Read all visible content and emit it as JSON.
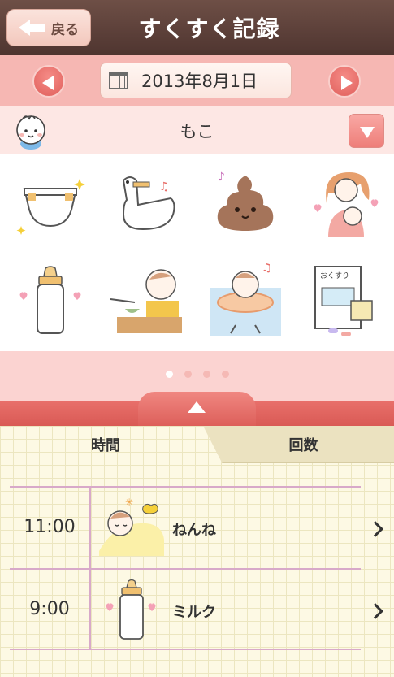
{
  "header": {
    "back_label": "戻る",
    "title": "すくすく記録"
  },
  "datebar": {
    "date": "2013年8月1日"
  },
  "baby": {
    "name": "もこ"
  },
  "grid": {
    "items": [
      {
        "icon": "diaper-icon"
      },
      {
        "icon": "potty-icon"
      },
      {
        "icon": "poop-icon"
      },
      {
        "icon": "breastfeeding-icon"
      },
      {
        "icon": "milk-bottle-icon"
      },
      {
        "icon": "baby-food-icon"
      },
      {
        "icon": "bath-icon"
      },
      {
        "icon": "medicine-icon",
        "label": "おくすり"
      }
    ]
  },
  "pager": {
    "count": 4,
    "active": 0
  },
  "tabs": {
    "time_label": "時間",
    "count_label": "回数"
  },
  "records": [
    {
      "time": "11:00",
      "label": "ねんね",
      "icon": "sleep-icon"
    },
    {
      "time": "9:00",
      "label": "ミルク",
      "icon": "milk-bottle-icon"
    }
  ],
  "colors": {
    "header": "#5e4139",
    "accent": "#e86f6a",
    "pink_light": "#fde7e4",
    "notebook": "#fdf9e4"
  }
}
